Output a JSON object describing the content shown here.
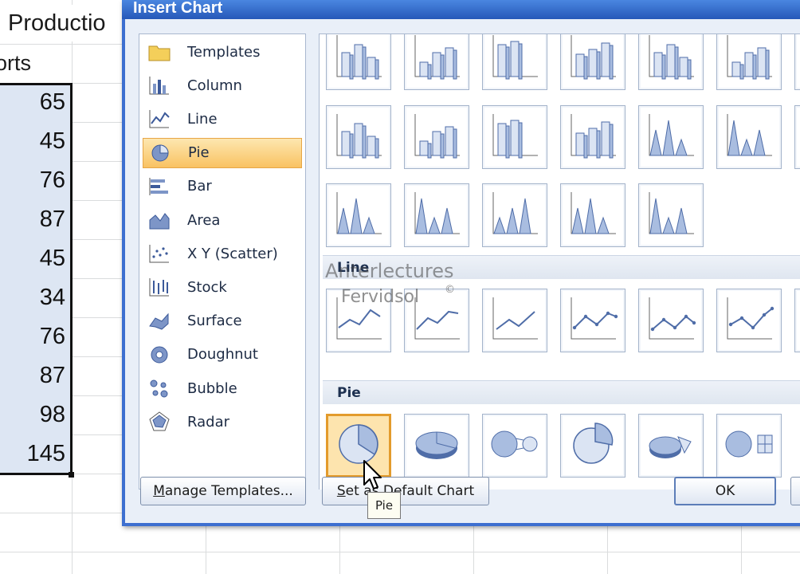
{
  "dialog": {
    "title": "Insert Chart"
  },
  "sheet": {
    "header_cell": "Productio",
    "column_header": "orts",
    "values": [
      "65",
      "45",
      "76",
      "87",
      "45",
      "34",
      "76",
      "87",
      "98",
      "145"
    ]
  },
  "categories": [
    {
      "label": "Templates",
      "icon": "folder-icon"
    },
    {
      "label": "Column",
      "icon": "column-chart-icon"
    },
    {
      "label": "Line",
      "icon": "line-chart-icon"
    },
    {
      "label": "Pie",
      "icon": "pie-chart-icon",
      "selected": true
    },
    {
      "label": "Bar",
      "icon": "bar-chart-icon"
    },
    {
      "label": "Area",
      "icon": "area-chart-icon"
    },
    {
      "label": "X Y (Scatter)",
      "icon": "scatter-chart-icon"
    },
    {
      "label": "Stock",
      "icon": "stock-chart-icon"
    },
    {
      "label": "Surface",
      "icon": "surface-chart-icon"
    },
    {
      "label": "Doughnut",
      "icon": "doughnut-chart-icon"
    },
    {
      "label": "Bubble",
      "icon": "bubble-chart-icon"
    },
    {
      "label": "Radar",
      "icon": "radar-chart-icon"
    }
  ],
  "gallery": {
    "sections": {
      "line": "Line",
      "pie": "Pie"
    },
    "selected_subtype": "Pie"
  },
  "watermark": {
    "line1": "Anterlectures",
    "line2": "Fervidsol",
    "mark": "©"
  },
  "buttons": {
    "manage_templates_prefix": "M",
    "manage_templates_rest": "anage Templates...",
    "set_default_prefix": "S",
    "set_default_rest": "et as Default Chart",
    "ok": "OK"
  },
  "tooltip": "Pie",
  "colors": {
    "title_bar": "#2e63c4",
    "selection": "#f9c262",
    "chart_blue": "#7d95c7"
  }
}
